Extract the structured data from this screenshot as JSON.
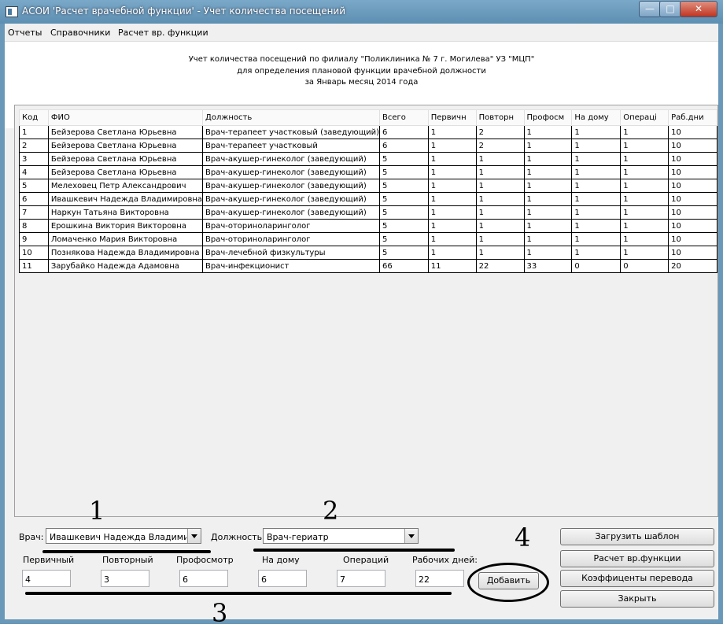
{
  "window": {
    "title": "АСОИ 'Расчет врачебной функции' - Учет количества посещений"
  },
  "menu": [
    "Отчеты",
    "Справочники",
    "Расчет вр. функции"
  ],
  "report_header": [
    "Учет количества посещений по филиалу \"Поликлиника № 7 г. Могилева\" УЗ \"МЦП\"",
    "для определения плановой функции  врачебной должности",
    "за Январь месяц 2014 года"
  ],
  "table": {
    "columns": [
      "Код",
      "ФИО",
      "Должность",
      "Всего",
      "Первичн",
      "Повторн",
      "Профосм",
      "На дому",
      "Операці",
      "Раб.дни"
    ],
    "rows": [
      [
        "1",
        "Бейзерова Светлана Юрьевна",
        "Врач-терапеет участковый (заведующий)",
        "6",
        "1",
        "2",
        "1",
        "1",
        "1",
        "10"
      ],
      [
        "2",
        "Бейзерова Светлана Юрьевна",
        "Врач-терапеет участковый",
        "6",
        "1",
        "2",
        "1",
        "1",
        "1",
        "10"
      ],
      [
        "3",
        "Бейзерова Светлана Юрьевна",
        "Врач-акушер-гинеколог (заведующий)",
        "5",
        "1",
        "1",
        "1",
        "1",
        "1",
        "10"
      ],
      [
        "4",
        "Бейзерова Светлана Юрьевна",
        "Врач-акушер-гинеколог (заведующий)",
        "5",
        "1",
        "1",
        "1",
        "1",
        "1",
        "10"
      ],
      [
        "5",
        "Мелеховец Петр Александрович",
        "Врач-акушер-гинеколог (заведующий)",
        "5",
        "1",
        "1",
        "1",
        "1",
        "1",
        "10"
      ],
      [
        "6",
        "Ивашкевич Надежда Владимировна",
        "Врач-акушер-гинеколог (заведующий)",
        "5",
        "1",
        "1",
        "1",
        "1",
        "1",
        "10"
      ],
      [
        "7",
        "Наркун Татьяна Викторовна",
        "Врач-акушер-гинеколог (заведующий)",
        "5",
        "1",
        "1",
        "1",
        "1",
        "1",
        "10"
      ],
      [
        "8",
        "Ерошкина Виктория Викторовна",
        "Врач-оториноларинголог",
        "5",
        "1",
        "1",
        "1",
        "1",
        "1",
        "10"
      ],
      [
        "9",
        "Ломаченко Мария Викторовна",
        "Врач-оториноларинголог",
        "5",
        "1",
        "1",
        "1",
        "1",
        "1",
        "10"
      ],
      [
        "10",
        "Познякова Надежда Владимировна",
        "Врач-лечебной физкультуры",
        "5",
        "1",
        "1",
        "1",
        "1",
        "1",
        "10"
      ],
      [
        "11",
        "Зарубайко Надежда Адамовна",
        "Врач-инфекционист",
        "66",
        "11",
        "22",
        "33",
        "0",
        "0",
        "20"
      ]
    ]
  },
  "form": {
    "doctor_label": "Врач:",
    "doctor_value": "Ивашкевич Надежда Владимиров",
    "position_label": "Должность:",
    "position_value": "Врач-гериатр",
    "fields": [
      {
        "label": "Первичный",
        "value": "4"
      },
      {
        "label": "Повторный",
        "value": "3"
      },
      {
        "label": "Профосмотр",
        "value": "6"
      },
      {
        "label": "На дому",
        "value": "6"
      },
      {
        "label": "Операций",
        "value": "7"
      },
      {
        "label": "Рабочих дней:",
        "value": "22"
      }
    ],
    "add_button": "Добавить"
  },
  "side_buttons": [
    "Загрузить шаблон",
    "Расчет вр.функции",
    "Коэффиценты перевода",
    "Закрыть"
  ],
  "annotations": [
    "1",
    "2",
    "3",
    "4"
  ]
}
